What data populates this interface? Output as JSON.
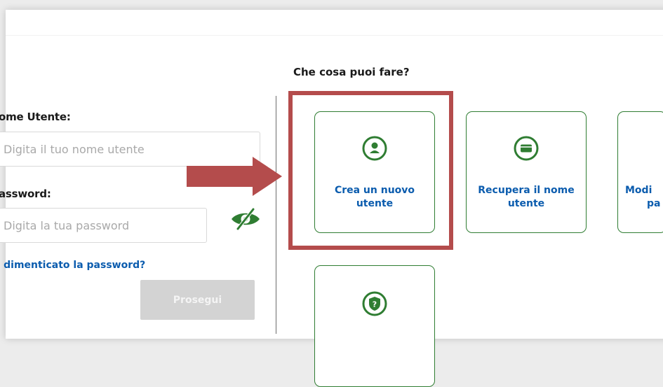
{
  "login": {
    "username_label": "ome Utente:",
    "username_placeholder": "Digita il tuo nome utente",
    "password_label": "assword:",
    "password_placeholder": "Digita la tua password",
    "forgot_password_link": "ai dimenticato la password?",
    "continue_button": "Prosegui",
    "toggle_icon": "eye-slash-icon"
  },
  "options": {
    "title": "Che cosa puoi fare?",
    "cards": [
      {
        "line1": "Crea un nuovo",
        "line2": "utente",
        "icon": "user-icon"
      },
      {
        "line1": "Recupera il nome",
        "line2": "utente",
        "icon": "card-icon"
      },
      {
        "line1": "Modi",
        "line2": "pa",
        "icon": "key-icon"
      },
      {
        "line1": "",
        "line2": "",
        "icon": "shield-question-icon"
      }
    ]
  },
  "colors": {
    "accent_green": "#2f7d32",
    "link_blue": "#0b5cae",
    "highlight_red": "#b44c4c",
    "disabled_button": "#d3d3d3"
  }
}
